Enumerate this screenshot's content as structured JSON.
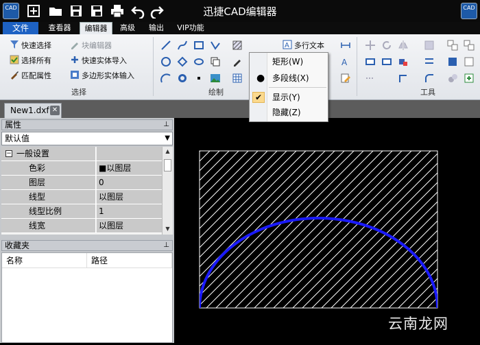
{
  "window": {
    "title": "迅捷CAD编辑器",
    "logo_text": "CAD"
  },
  "menu": {
    "file": "文件",
    "tabs": [
      "查看器",
      "编辑器",
      "高级",
      "输出",
      "VIP功能"
    ],
    "active_tab": "编辑器"
  },
  "ribbon": {
    "select_group": {
      "label": "选择",
      "quick_select": "快速选择",
      "block_editor": "块编辑器",
      "select_all": "选择所有",
      "quick_import": "快速实体导入",
      "match_props": "匹配属性",
      "polygon_input": "多边形实体输入"
    },
    "draw_group": {
      "label": "绘制"
    },
    "mtext_label": "多行文本",
    "tools_group": {
      "label": "工具"
    }
  },
  "dropdown": {
    "items": [
      {
        "label": "矩形(W)"
      },
      {
        "label": "多段线(X)"
      },
      {
        "label": "显示(Y)"
      },
      {
        "label": "隐藏(Z)"
      }
    ]
  },
  "document": {
    "tab_name": "New1.dxf"
  },
  "properties": {
    "title": "属性",
    "combo_value": "默认值",
    "section": "一般设置",
    "rows": [
      {
        "name": "色彩",
        "value": "■以图层"
      },
      {
        "name": "图层",
        "value": "0"
      },
      {
        "name": "线型",
        "value": "以图层"
      },
      {
        "name": "线型比例",
        "value": "1"
      },
      {
        "name": "线宽",
        "value": "以图层"
      }
    ]
  },
  "favorites": {
    "title": "收藏夹",
    "columns": [
      "名称",
      "路径"
    ]
  },
  "watermark": "云南龙网",
  "colors": {
    "accent_blue": "#1e62c3",
    "arc_blue": "#1a1aff",
    "highlight": "#fbd98d"
  }
}
